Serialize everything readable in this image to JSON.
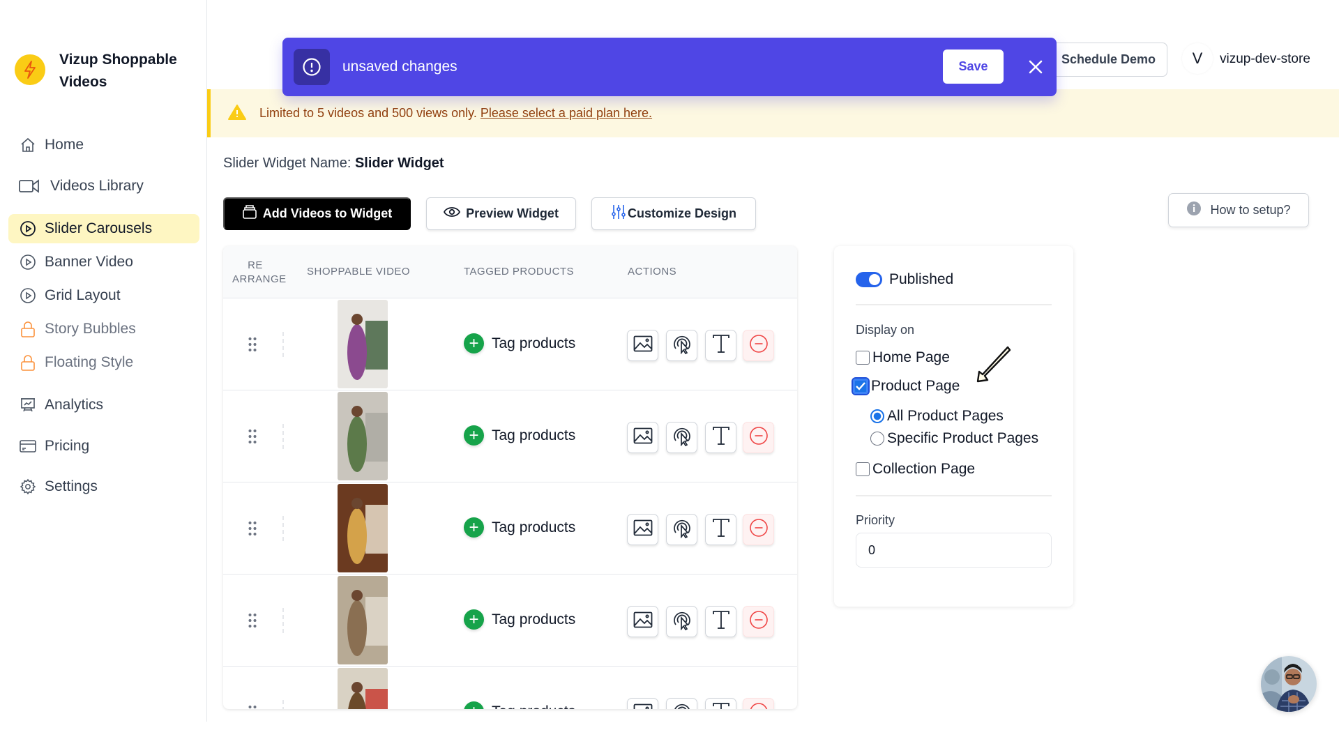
{
  "app": {
    "name": "Vizup Shoppable Videos",
    "logo_icon": "lightning-icon"
  },
  "sidebar": {
    "items": [
      {
        "label": "Home",
        "icon": "home-icon",
        "active": false,
        "locked": false
      },
      {
        "label": "Videos Library",
        "icon": "video-camera-icon",
        "active": false,
        "locked": false
      },
      {
        "label": "Slider Carousels",
        "icon": "play-circle-icon",
        "active": true,
        "locked": false
      },
      {
        "label": "Banner Video",
        "icon": "play-circle-icon",
        "active": false,
        "locked": false
      },
      {
        "label": "Grid Layout",
        "icon": "play-circle-icon",
        "active": false,
        "locked": false
      },
      {
        "label": "Story Bubbles",
        "icon": "lock-icon",
        "active": false,
        "locked": true
      },
      {
        "label": "Floating Style",
        "icon": "lock-icon",
        "active": false,
        "locked": true
      },
      {
        "label": "Analytics",
        "icon": "presentation-chart-icon",
        "active": false,
        "locked": false
      },
      {
        "label": "Pricing",
        "icon": "credit-card-icon",
        "active": false,
        "locked": false
      },
      {
        "label": "Settings",
        "icon": "gear-icon",
        "active": false,
        "locked": false
      }
    ]
  },
  "header": {
    "schedule_demo": "Schedule Demo",
    "user_initial": "V",
    "store_name": "vizup-dev-store"
  },
  "unsaved_banner": {
    "message": "unsaved changes",
    "save_label": "Save",
    "icon": "exclamation-circle-icon",
    "accent": "#4f46e5"
  },
  "warning": {
    "text": "Limited to 5 videos and 500 views only.",
    "link_text": "Please select a paid plan here."
  },
  "widget": {
    "name_label": "Slider Widget Name:",
    "name_value": "Slider Widget"
  },
  "toolbar": {
    "add_videos": "Add Videos to Widget",
    "preview": "Preview Widget",
    "customize": "Customize Design",
    "how_to": "How to setup?"
  },
  "table": {
    "headers": {
      "rearrange_1": "RE",
      "rearrange_2": "ARRANGE",
      "video": "SHOPPABLE VIDEO",
      "products": "TAGGED PRODUCTS",
      "actions": "ACTIONS"
    },
    "rows": [
      {
        "tag_label": "Tag products"
      },
      {
        "tag_label": "Tag products"
      },
      {
        "tag_label": "Tag products"
      },
      {
        "tag_label": "Tag products"
      },
      {
        "tag_label": "Tag products"
      }
    ]
  },
  "panel": {
    "published_label": "Published",
    "published": true,
    "display_on_label": "Display on",
    "home_page": "Home Page",
    "home_checked": false,
    "product_page": "Product Page",
    "product_checked": true,
    "all_product_pages": "All Product Pages",
    "specific_product_pages": "Specific Product Pages",
    "selected_product_scope": "All Product Pages",
    "collection_page": "Collection Page",
    "collection_checked": false,
    "priority_label": "Priority",
    "priority_value": "0"
  }
}
